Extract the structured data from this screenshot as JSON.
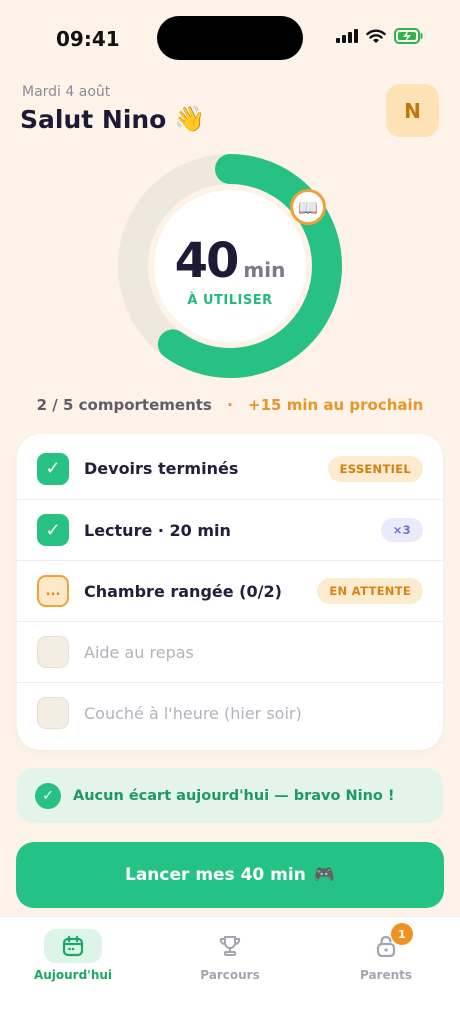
{
  "status_bar": {
    "time": "09:41"
  },
  "header": {
    "date": "Mardi 4 août",
    "greeting": "Salut Nino",
    "greeting_emoji": "👋",
    "avatar_initial": "N"
  },
  "timer": {
    "minutes": "40",
    "unit": "min",
    "label": "À UTILISER",
    "ring_fill_fraction": 0.6,
    "badge_emoji": "📖",
    "colors": {
      "progress": "#27c283",
      "track": "#efe8dd",
      "badge_border": "#f0a23a"
    }
  },
  "progress": {
    "count": "2 / 5 comportements",
    "separator": "·",
    "next": "+15 min au prochain"
  },
  "behaviors": [
    {
      "label": "Devoirs terminés",
      "state": "done",
      "check": "✓",
      "pill": "ESSENTIEL"
    },
    {
      "label": "Lecture · 20 min",
      "state": "done",
      "check": "✓",
      "pill": "×3"
    },
    {
      "label": "Chambre rangée  (0/2)",
      "state": "pending",
      "check": "...",
      "pill": "EN ATTENTE"
    },
    {
      "label": "Aide au repas",
      "state": "todo"
    },
    {
      "label": "Couché à l'heure (hier soir)",
      "state": "todo"
    }
  ],
  "banner": {
    "icon": "✓",
    "text": "Aucun écart aujourd'hui — bravo Nino !"
  },
  "cta": {
    "label": "Lancer mes 40 min",
    "emoji": "🎮"
  },
  "tabbar": {
    "tabs": [
      {
        "label": "Aujourd'hui",
        "icon": "calendar-icon",
        "active": true
      },
      {
        "label": "Parcours",
        "icon": "trophy-icon",
        "active": false
      },
      {
        "label": "Parents",
        "icon": "lock-icon",
        "active": false,
        "badge": "1"
      }
    ]
  },
  "colors": {
    "background": "#fdf3e8",
    "accent_green": "#27c283",
    "accent_orange": "#f0a23a",
    "ink": "#1e1a36"
  }
}
